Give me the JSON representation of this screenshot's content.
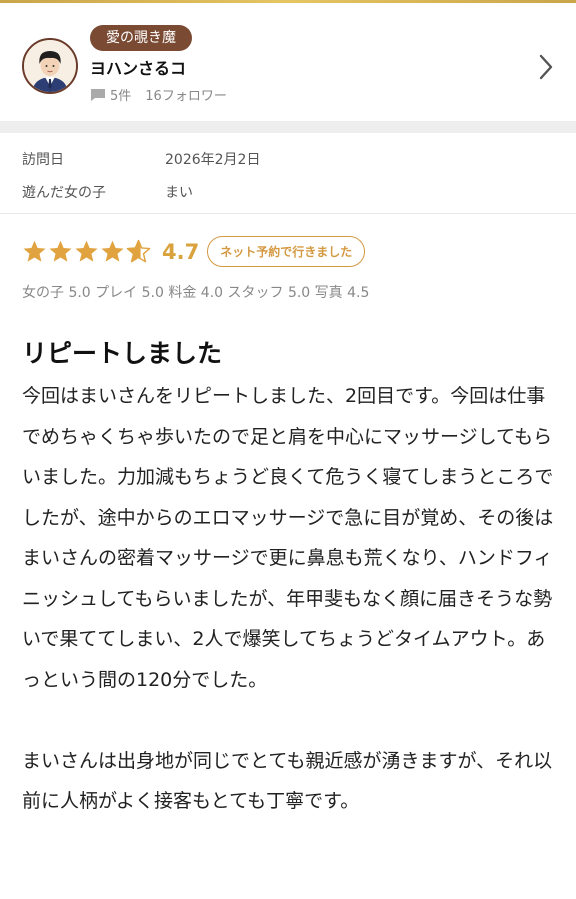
{
  "profile": {
    "badge": "愛の覗き魔",
    "name": "ヨハンさるコ",
    "review_count": "5件",
    "followers": "16フォロワー"
  },
  "visit": {
    "date_label": "訪問日",
    "date_value": "2026年2月2日",
    "girl_label": "遊んだ女の子",
    "girl_value": "まい"
  },
  "rating": {
    "score": "4.7",
    "stars": 4.7,
    "booking_badge": "ネット予約で行きました",
    "breakdown": "女の子 5.0 プレイ 5.0 料金 4.0 スタッフ 5.0 写真 4.5",
    "star_color": "#e0a33f"
  },
  "review": {
    "title": "リピートしました",
    "paragraph1": "今回はまいさんをリピートしました、2回目です。今回は仕事でめちゃくちゃ歩いたので足と肩を中心にマッサージしてもらいました。力加減もちょうど良くて危うく寝てしまうところでしたが、途中からのエロマッサージで急に目が覚め、その後はまいさんの密着マッサージで更に鼻息も荒くなり、ハンドフィニッシュしてもらいましたが、年甲斐もなく顔に届きそうな勢いで果ててしまい、2人で爆笑してちょうどタイムアウト。あっという間の120分でした。",
    "paragraph2": "まいさんは出身地が同じでとても親近感が湧きますが、それ以前に人柄がよく接客もとても丁寧です。"
  }
}
